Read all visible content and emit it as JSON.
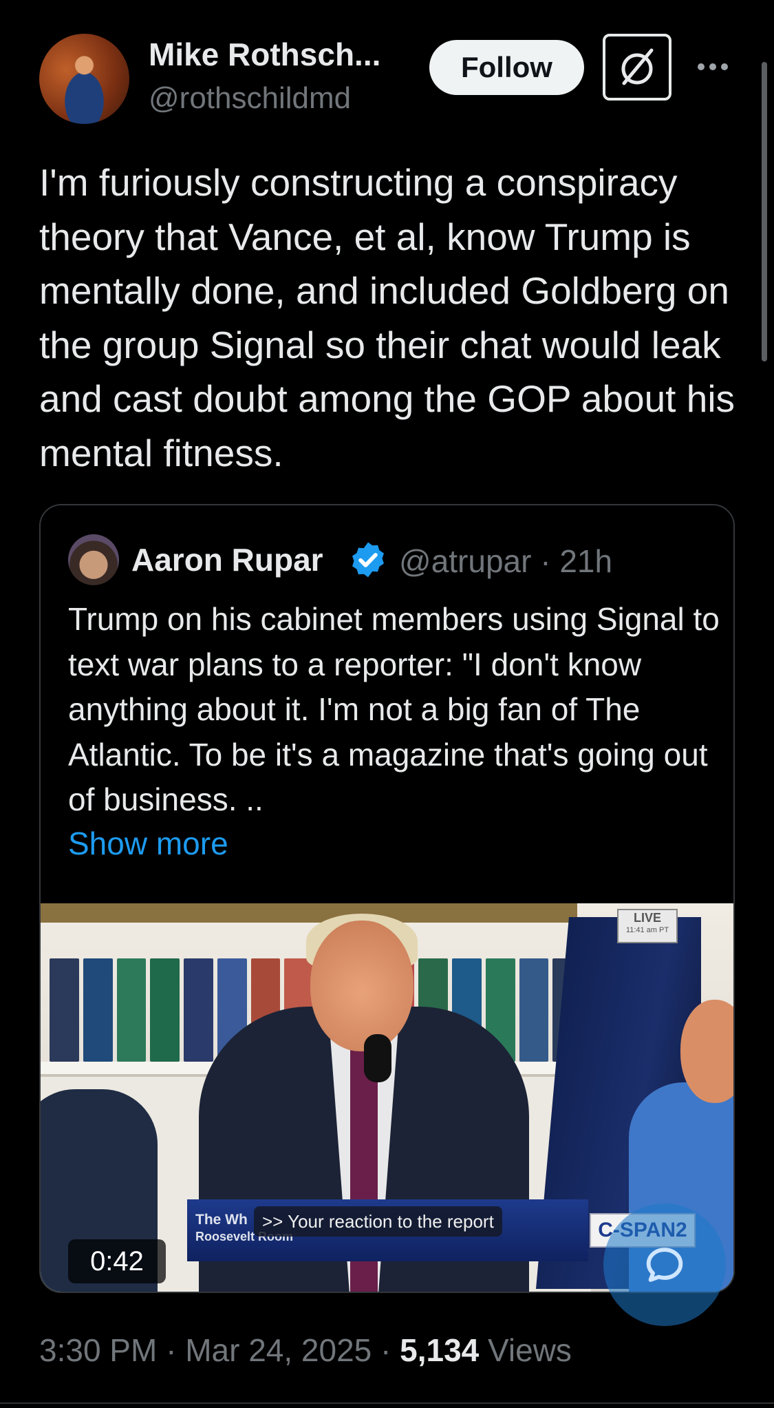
{
  "author": {
    "name": "Mike Rothsch...",
    "handle": "@rothschildmd"
  },
  "actions": {
    "follow_label": "Follow"
  },
  "tweet": {
    "text": "I'm furiously constructing a conspiracy theory that Vance, et al, know Trump is mentally done, and included Goldberg on the group Signal so their chat would leak and cast doubt among the GOP about his mental fitness."
  },
  "quote": {
    "name": "Aaron Rupar",
    "handle_time": "@atrupar · 21h",
    "text": "Trump on his cabinet members using Signal to text war plans to a reporter: \"I don't know anything about it. I'm not a big fan of The Atlantic. To be it's a magazine that's going out of business. ..",
    "show_more": "Show more",
    "video": {
      "duration": "0:42",
      "live_label": "LIVE",
      "live_time": "11:41 am PT",
      "lower_third_line1": "The Wh",
      "lower_third_line2": "Roosevelt Room",
      "caption": ">> Your reaction to the report",
      "network": "C-SPAN2"
    }
  },
  "meta": {
    "time_date": "3:30 PM · Mar 24, 2025 · ",
    "views_count": "5,134",
    "views_label": " Views"
  },
  "colors": {
    "background": "#000000",
    "text": "#e7e9ea",
    "secondary": "#71767b",
    "accent": "#1d9bf0"
  }
}
